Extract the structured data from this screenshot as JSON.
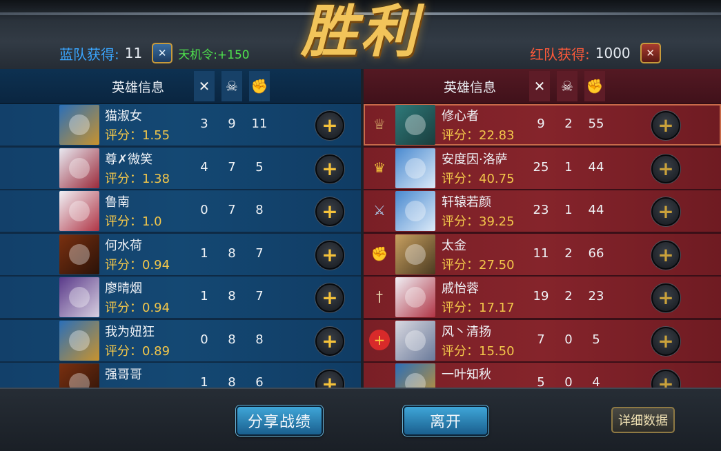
{
  "title": "胜利",
  "blue": {
    "score_label": "蓝队获得:",
    "score_value": "11",
    "emblem_icon": "blue-team-shield-icon",
    "tianji": "天机令:+150",
    "header": "英雄信息",
    "players": [
      {
        "name": "猫淑女",
        "score": "评分：1.55",
        "k": "3",
        "d": "9",
        "a": "11"
      },
      {
        "name": "尊✗微笑",
        "score": "评分：1.38",
        "k": "4",
        "d": "7",
        "a": "5"
      },
      {
        "name": "鲁南",
        "score": "评分：1.0",
        "k": "0",
        "d": "7",
        "a": "8"
      },
      {
        "name": "何水荷",
        "score": "评分：0.94",
        "k": "1",
        "d": "8",
        "a": "7"
      },
      {
        "name": "廖晴烟",
        "score": "评分：0.94",
        "k": "1",
        "d": "8",
        "a": "7"
      },
      {
        "name": "我为妞狂",
        "score": "评分：0.89",
        "k": "0",
        "d": "8",
        "a": "8"
      },
      {
        "name": "强哥哥",
        "score": "",
        "k": "1",
        "d": "8",
        "a": "6"
      }
    ]
  },
  "red": {
    "score_label": "红队获得:",
    "score_value": "1000",
    "emblem_icon": "red-team-shield-icon",
    "header": "英雄信息",
    "players": [
      {
        "name": "修心者",
        "score": "评分：22.83",
        "k": "9",
        "d": "2",
        "a": "55",
        "badge": "laurel-award-icon"
      },
      {
        "name": "安度因·洛萨",
        "score": "评分：40.75",
        "k": "25",
        "d": "1",
        "a": "44",
        "badge": "crown-mvp-icon"
      },
      {
        "name": "轩辕若颜",
        "score": "评分：39.25",
        "k": "23",
        "d": "1",
        "a": "44",
        "badge": "crossed-swords-icon"
      },
      {
        "name": "太金",
        "score": "评分：27.50",
        "k": "11",
        "d": "2",
        "a": "66",
        "badge": "fist-icon"
      },
      {
        "name": "戚怡蓉",
        "score": "评分：17.17",
        "k": "19",
        "d": "2",
        "a": "23",
        "badge": "sword-icon"
      },
      {
        "name": "风丶清扬",
        "score": "评分：15.50",
        "k": "7",
        "d": "0",
        "a": "5",
        "badge": "heart-plus-icon"
      },
      {
        "name": "一叶知秋",
        "score": "",
        "k": "5",
        "d": "0",
        "a": "4",
        "badge": ""
      }
    ]
  },
  "column_icons": [
    "crossed-swords-kills-icon",
    "skull-deaths-icon",
    "fist-assists-icon"
  ],
  "add_icon": "plus-icon",
  "buttons": {
    "share": "分享战绩",
    "leave": "离开",
    "details": "详细数据"
  }
}
